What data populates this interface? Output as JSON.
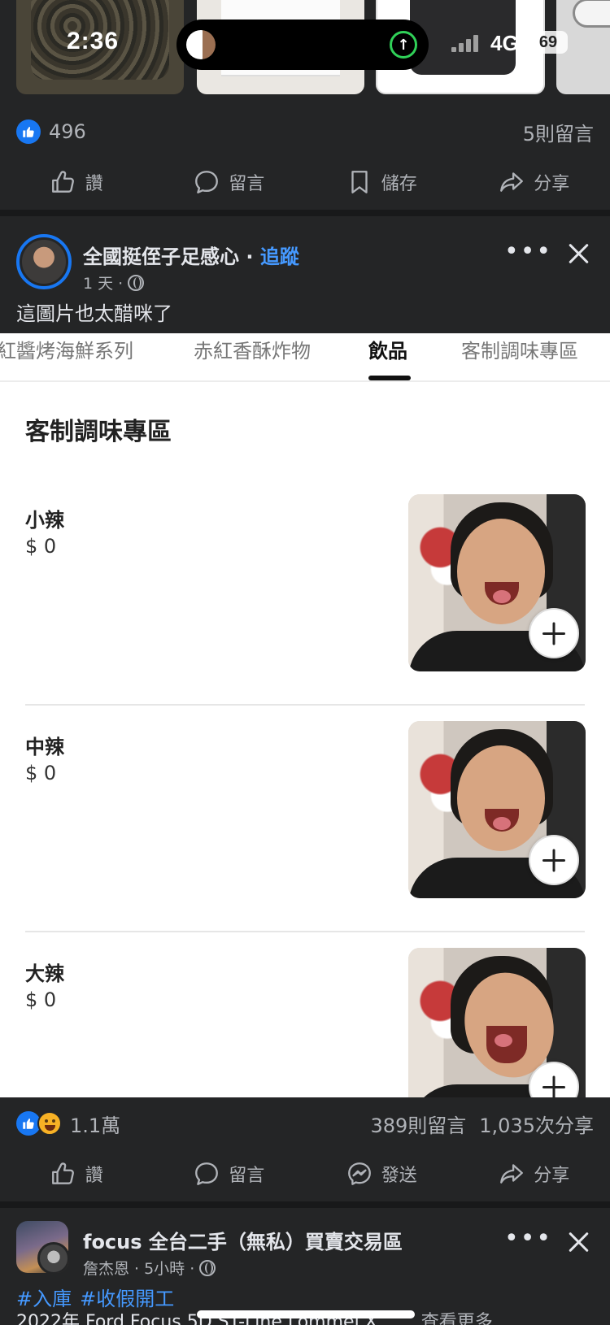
{
  "status_bar": {
    "time": "2:36",
    "network": "4G",
    "battery": "69"
  },
  "post1": {
    "likes": "496",
    "comments": "5則留言",
    "actions": [
      "讚",
      "留言",
      "儲存",
      "分享"
    ]
  },
  "post2": {
    "page_name": "全國挺侄子足感心",
    "follow": "追蹤",
    "time": "1 天 ·",
    "caption": "這圖片也太醋咪了",
    "menu": {
      "tabs": [
        "紅醬烤海鮮系列",
        "赤紅香酥炸物",
        "飲品",
        "客制調味專區"
      ],
      "active_tab": "飲品",
      "section_title": "客制調味專區",
      "items": [
        {
          "name": "小辣",
          "price": "$ 0"
        },
        {
          "name": "中辣",
          "price": "$ 0"
        },
        {
          "name": "大辣",
          "price": "$ 0"
        }
      ]
    },
    "reactions": "1.1萬",
    "comments": "389則留言",
    "shares": "1,035次分享",
    "actions": [
      "讚",
      "留言",
      "發送",
      "分享"
    ]
  },
  "post3": {
    "group_name": "focus 全台二手（無私）買賣交易區",
    "author": "詹杰恩",
    "time": "· 5小時 ·",
    "hashtags": [
      "#入庫",
      "#收假開工"
    ],
    "preview": "2022年 Ford Focus 5D ST-Line Lommel X……",
    "see_more": "查看更多"
  },
  "colors": {
    "accent": "#1877f2",
    "link": "#4599ff",
    "background": "#242526"
  }
}
